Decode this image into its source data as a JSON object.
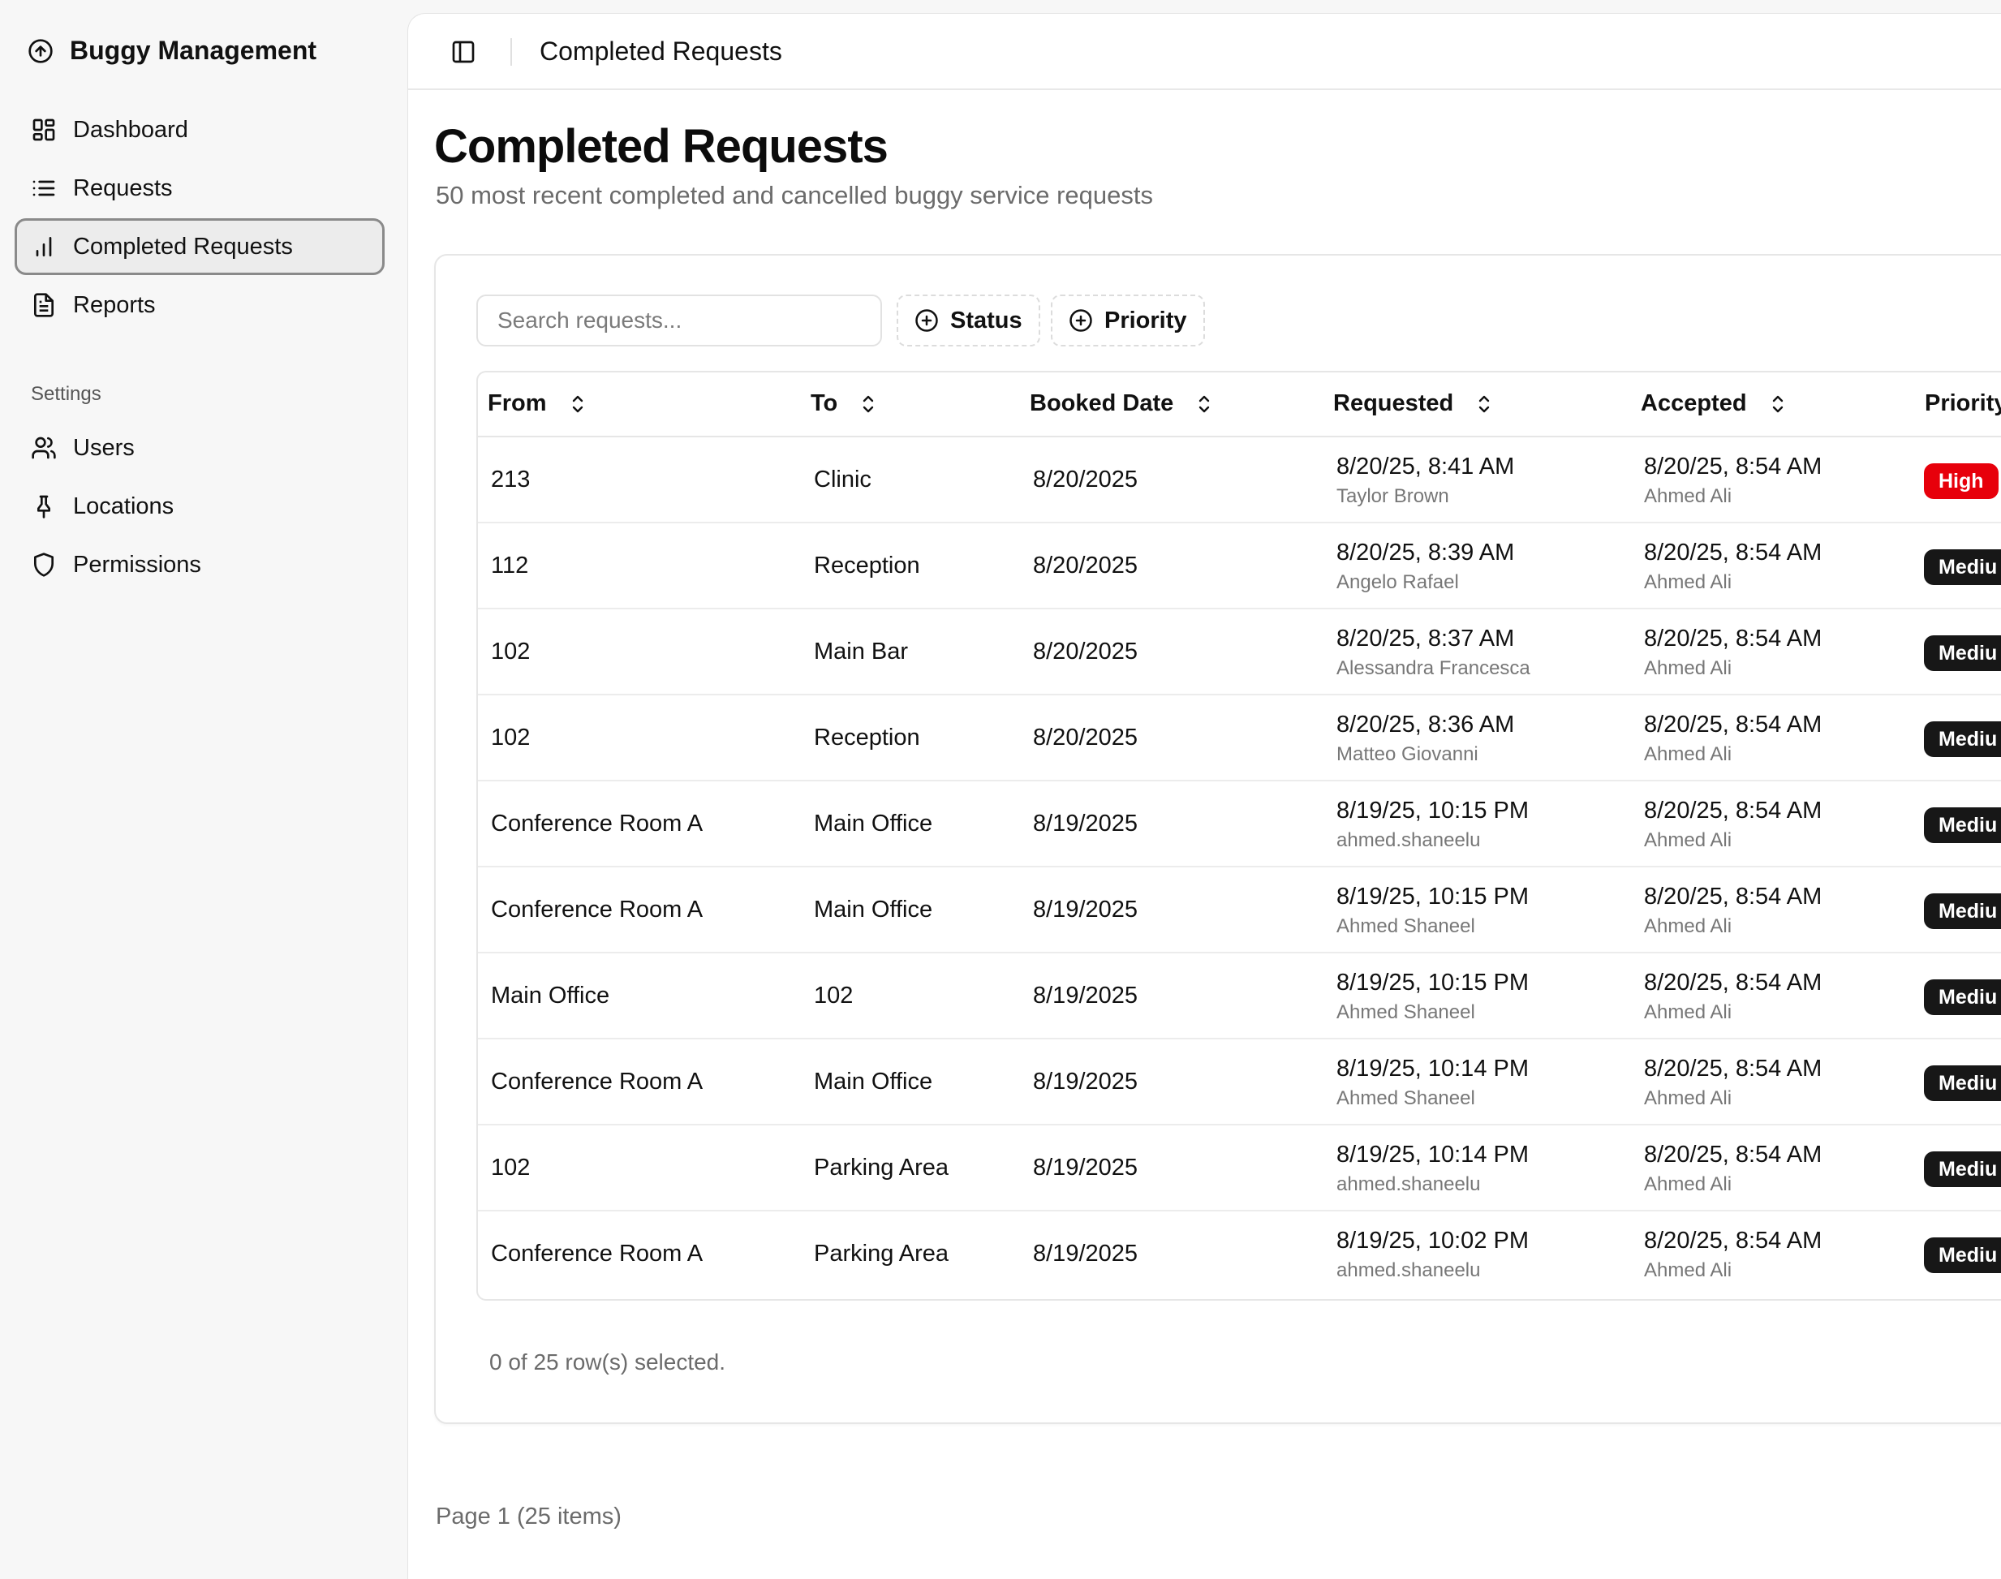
{
  "app": {
    "title": "Buggy Management"
  },
  "sidebar": {
    "items": [
      {
        "label": "Dashboard",
        "icon": "dashboard-icon"
      },
      {
        "label": "Requests",
        "icon": "list-icon"
      },
      {
        "label": "Completed Requests",
        "icon": "bar-chart-icon",
        "active": true
      },
      {
        "label": "Reports",
        "icon": "file-icon"
      }
    ],
    "settings_label": "Settings",
    "settings_items": [
      {
        "label": "Users",
        "icon": "users-icon"
      },
      {
        "label": "Locations",
        "icon": "pin-icon"
      },
      {
        "label": "Permissions",
        "icon": "shield-icon"
      }
    ]
  },
  "topbar": {
    "breadcrumb": "Completed Requests"
  },
  "page": {
    "title": "Completed Requests",
    "subtitle": "50 most recent completed and cancelled buggy service requests"
  },
  "toolbar": {
    "search_placeholder": "Search requests...",
    "status_label": "Status",
    "priority_label": "Priority"
  },
  "table": {
    "columns": [
      "From",
      "To",
      "Booked Date",
      "Requested",
      "Accepted",
      "Priority"
    ],
    "rows": [
      {
        "from": "213",
        "to": "Clinic",
        "booked": "8/20/2025",
        "requested": "8/20/25, 8:41 AM",
        "requested_by": "Taylor Brown",
        "accepted": "8/20/25, 8:54 AM",
        "accepted_by": "Ahmed Ali",
        "priority": "High"
      },
      {
        "from": "112",
        "to": "Reception",
        "booked": "8/20/2025",
        "requested": "8/20/25, 8:39 AM",
        "requested_by": "Angelo Rafael",
        "accepted": "8/20/25, 8:54 AM",
        "accepted_by": "Ahmed Ali",
        "priority": "Mediu"
      },
      {
        "from": "102",
        "to": "Main Bar",
        "booked": "8/20/2025",
        "requested": "8/20/25, 8:37 AM",
        "requested_by": "Alessandra Francesca",
        "accepted": "8/20/25, 8:54 AM",
        "accepted_by": "Ahmed Ali",
        "priority": "Mediu"
      },
      {
        "from": "102",
        "to": "Reception",
        "booked": "8/20/2025",
        "requested": "8/20/25, 8:36 AM",
        "requested_by": "Matteo Giovanni",
        "accepted": "8/20/25, 8:54 AM",
        "accepted_by": "Ahmed Ali",
        "priority": "Mediu"
      },
      {
        "from": "Conference Room A",
        "to": "Main Office",
        "booked": "8/19/2025",
        "requested": "8/19/25, 10:15 PM",
        "requested_by": "ahmed.shaneelu",
        "accepted": "8/20/25, 8:54 AM",
        "accepted_by": "Ahmed Ali",
        "priority": "Mediu"
      },
      {
        "from": "Conference Room A",
        "to": "Main Office",
        "booked": "8/19/2025",
        "requested": "8/19/25, 10:15 PM",
        "requested_by": "Ahmed Shaneel",
        "accepted": "8/20/25, 8:54 AM",
        "accepted_by": "Ahmed Ali",
        "priority": "Mediu"
      },
      {
        "from": "Main Office",
        "to": "102",
        "booked": "8/19/2025",
        "requested": "8/19/25, 10:15 PM",
        "requested_by": "Ahmed Shaneel",
        "accepted": "8/20/25, 8:54 AM",
        "accepted_by": "Ahmed Ali",
        "priority": "Mediu"
      },
      {
        "from": "Conference Room A",
        "to": "Main Office",
        "booked": "8/19/2025",
        "requested": "8/19/25, 10:14 PM",
        "requested_by": "Ahmed Shaneel",
        "accepted": "8/20/25, 8:54 AM",
        "accepted_by": "Ahmed Ali",
        "priority": "Mediu"
      },
      {
        "from": "102",
        "to": "Parking Area",
        "booked": "8/19/2025",
        "requested": "8/19/25, 10:14 PM",
        "requested_by": "ahmed.shaneelu",
        "accepted": "8/20/25, 8:54 AM",
        "accepted_by": "Ahmed Ali",
        "priority": "Mediu"
      },
      {
        "from": "Conference Room A",
        "to": "Parking Area",
        "booked": "8/19/2025",
        "requested": "8/19/25, 10:02 PM",
        "requested_by": "ahmed.shaneelu",
        "accepted": "8/20/25, 8:54 AM",
        "accepted_by": "Ahmed Ali",
        "priority": "Mediu"
      }
    ],
    "selection_info": "0 of 25 row(s) selected."
  },
  "pagination": {
    "label": "Page 1 (25 items)"
  },
  "colors": {
    "high": "#e7000b",
    "medium": "#171717",
    "active_border": "#8a8a8a"
  }
}
